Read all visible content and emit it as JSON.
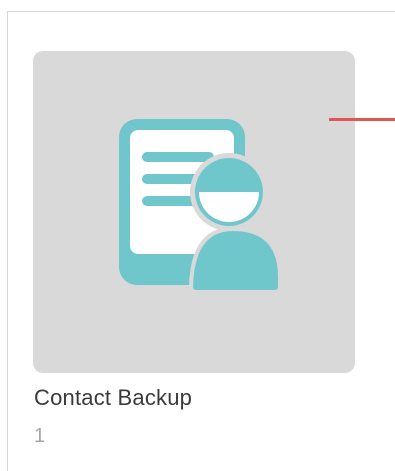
{
  "album": {
    "title": "Contact Backup",
    "count": "1",
    "icon": "contact-backup-icon",
    "tile_color": "#d9d9d9",
    "icon_color": "#6fc7cc"
  },
  "indicator": {
    "color": "#e15554"
  }
}
